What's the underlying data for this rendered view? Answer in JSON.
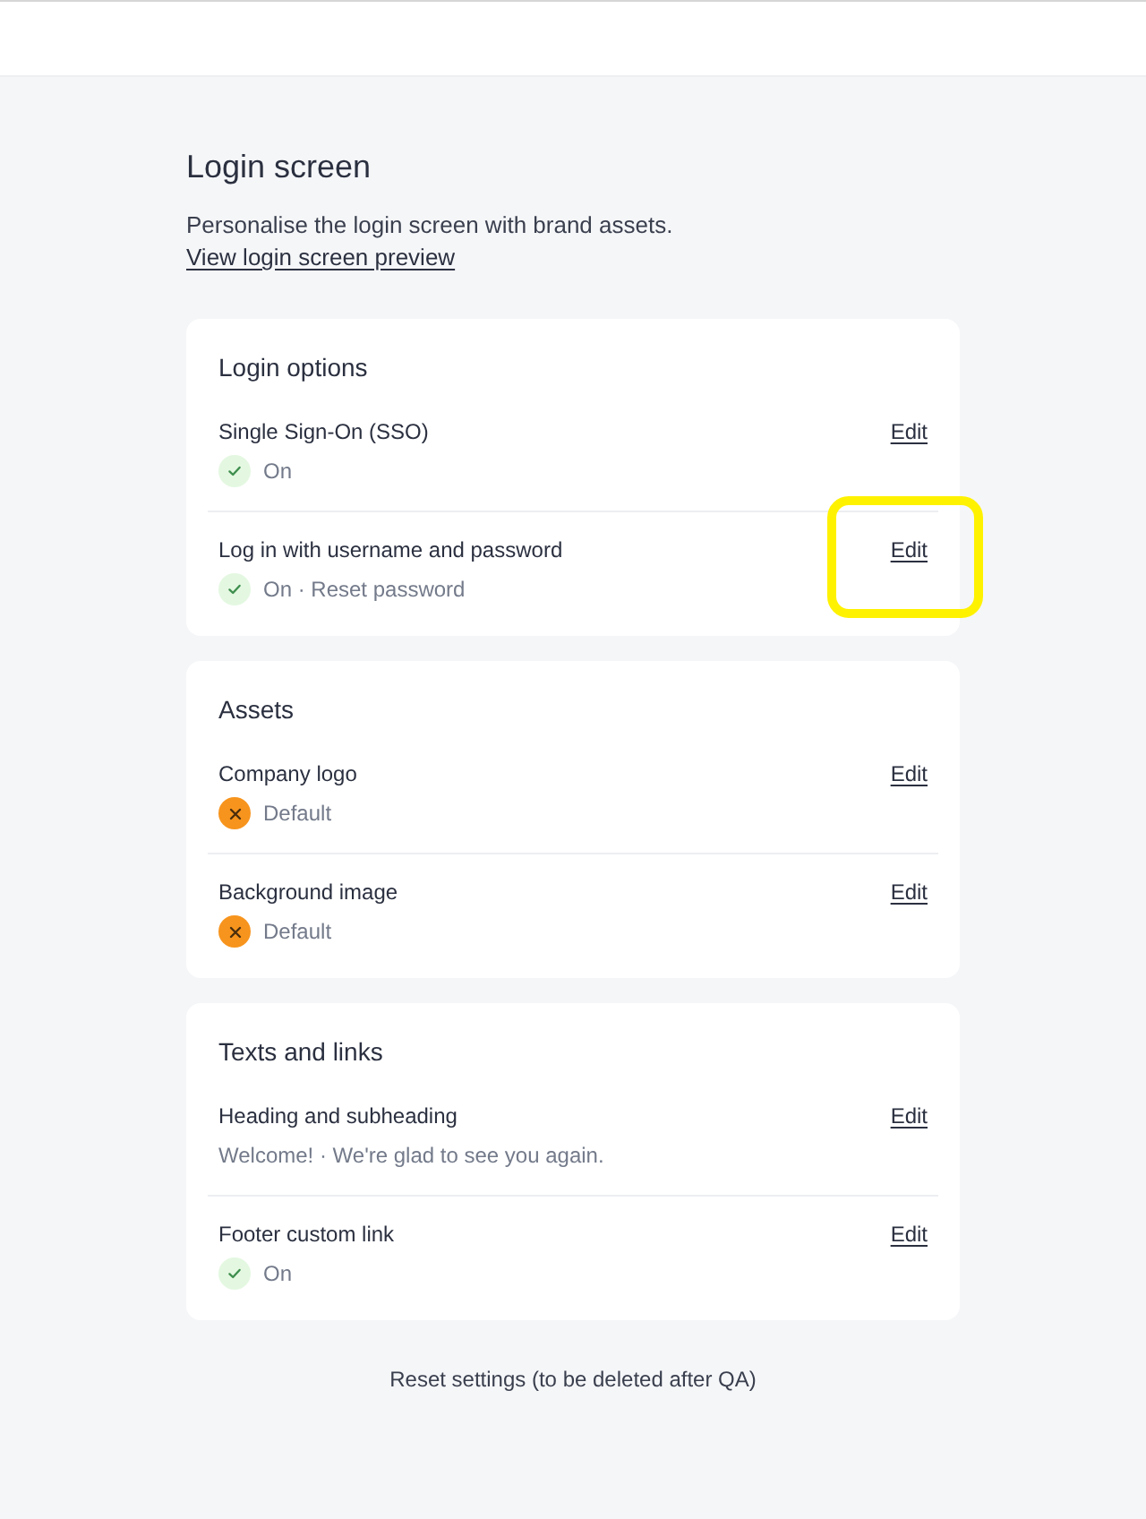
{
  "page": {
    "title": "Login screen",
    "description": "Personalise the login screen with brand assets.",
    "preview_link": "View login screen preview"
  },
  "sections": [
    {
      "title": "Login options",
      "items": [
        {
          "label": "Single Sign-On (SSO)",
          "kind": "on",
          "status": "On",
          "action": "Edit",
          "highlighted": false
        },
        {
          "label": "Log in with username and password",
          "kind": "on",
          "status": "On · Reset password",
          "action": "Edit",
          "highlighted": true
        }
      ]
    },
    {
      "title": "Assets",
      "items": [
        {
          "label": "Company logo",
          "kind": "default",
          "status": "Default",
          "action": "Edit",
          "highlighted": false
        },
        {
          "label": "Background image",
          "kind": "default",
          "status": "Default",
          "action": "Edit",
          "highlighted": false
        }
      ]
    },
    {
      "title": "Texts and links",
      "items": [
        {
          "label": "Heading and subheading",
          "kind": "text",
          "status": "Welcome! · We're glad to see you again.",
          "action": "Edit",
          "highlighted": false
        },
        {
          "label": "Footer custom link",
          "kind": "on",
          "status": "On",
          "action": "Edit",
          "highlighted": false
        }
      ]
    }
  ],
  "reset_button": "Reset settings (to be deleted after QA)"
}
